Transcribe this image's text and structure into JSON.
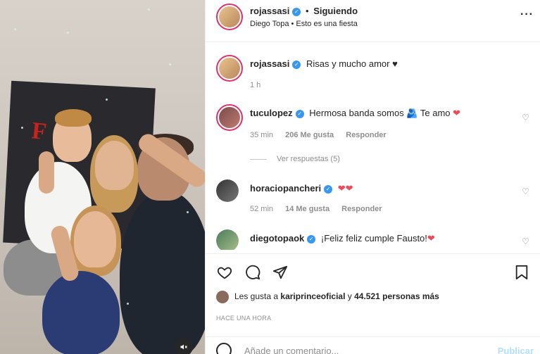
{
  "post": {
    "author": "rojassasi",
    "following_label": "Siguiendo",
    "subtitle": "Diego Topa • Esto es una fiesta",
    "more_icon": "more-horizontal-icon"
  },
  "caption": {
    "user": "rojassasi",
    "text": "Risas y mucho amor ♥",
    "time": "1 h"
  },
  "comments": [
    {
      "user": "tuculopez",
      "text": "Hermosa banda somos",
      "emoji": "🫂",
      "text_after": " Te amo",
      "heart": "❤",
      "time": "35 min",
      "likes": "206 Me gusta",
      "reply": "Responder",
      "view_replies": "Ver respuestas (5)"
    },
    {
      "user": "horaciopancheri",
      "text": "",
      "heart": "❤❤",
      "time": "52 min",
      "likes": "14 Me gusta",
      "reply": "Responder"
    },
    {
      "user": "diegotopaok",
      "text": "¡Feliz feliz cumple Fausto!",
      "heart": "❤"
    }
  ],
  "likes": {
    "prefix": "Les gusta a ",
    "user": "kariprinceoficial",
    "connector": " y ",
    "count": "44.521 personas más"
  },
  "time_ago": "HACE UNA HORA",
  "comment_box": {
    "placeholder": "Añade un comentario...",
    "publish": "Publicar"
  },
  "colors": {
    "verified": "#3897f0",
    "heart": "#ed4956",
    "muted": "#8e8e8e"
  }
}
